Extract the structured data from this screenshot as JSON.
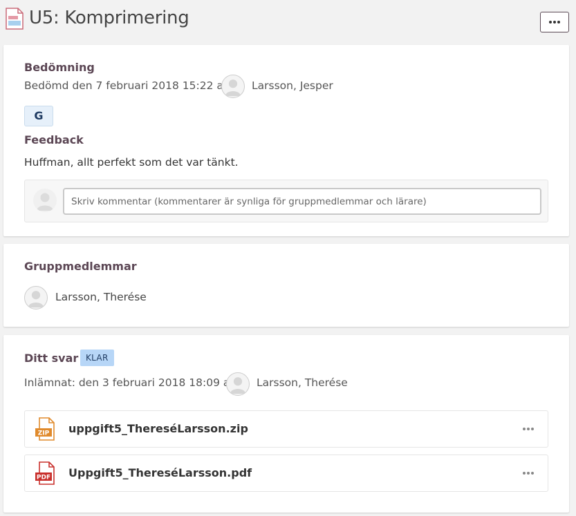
{
  "header": {
    "title": "U5: Komprimering",
    "icon": "document-icon",
    "more_icon": "more-options-icon"
  },
  "assessment": {
    "heading": "Bedömning",
    "assessed_text": "Bedömd den 7 februari 2018 15:22 av",
    "assessor": "Larsson, Jesper",
    "grade": "G",
    "feedback_heading": "Feedback",
    "feedback_text": "Huffman, allt perfekt som det var tänkt.",
    "comment_placeholder": "Skriv kommentar (kommentarer är synliga för gruppmedlemmar och lärare)"
  },
  "group": {
    "heading": "Gruppmedlemmar",
    "members": [
      "Larsson, Therése"
    ]
  },
  "answer": {
    "heading": "Ditt svar",
    "status_badge": "KLAR",
    "submitted_text": "Inlämnat: den 3 februari 2018 18:09 av",
    "submitter": "Larsson, Therése",
    "files": [
      {
        "name": "uppgift5_ThereséLarsson.zip",
        "type_label": "ZIP",
        "icon": "zip-file-icon"
      },
      {
        "name": "Uppgift5_ThereséLarsson.pdf",
        "type_label": "PDF",
        "icon": "pdf-file-icon"
      }
    ]
  },
  "colors": {
    "heading": "#5b4654",
    "badge_bg": "#b7d6f7",
    "grade_bg": "#e6f0fa",
    "zip_orange": "#e08a2c",
    "pdf_red": "#c9302c"
  }
}
